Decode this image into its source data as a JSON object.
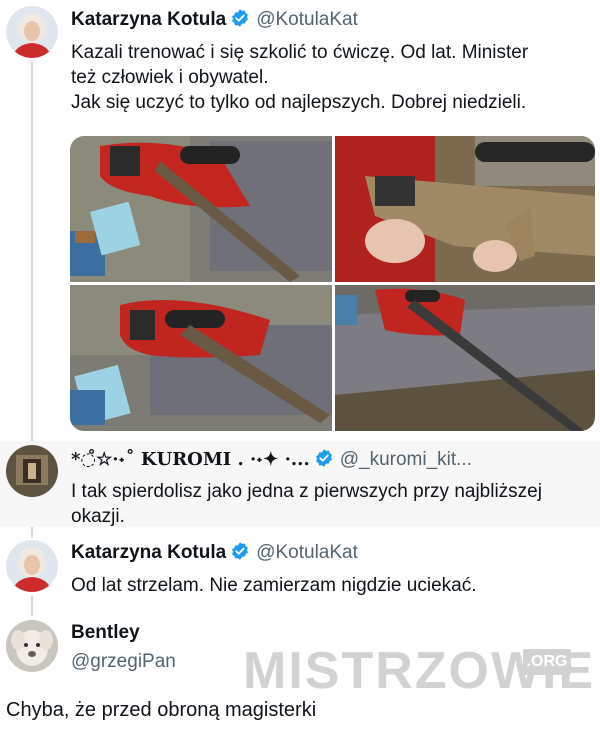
{
  "tweet1": {
    "author_name": "Katarzyna Kotula",
    "author_handle": "@KotulaKat",
    "text_line1": "Kazali trenować i się szkolić to ćwiczę. Od lat. Minister",
    "text_line2": "też człowiek i obywatel.",
    "text_line3": "Jak się uczyć to tylko od najlepszych. Dobrej niedzieli."
  },
  "reply1": {
    "author_name": "*◌̊☆·˖˚ 𝐊𝐔𝐑𝐎𝐌𝐈 .  ·˖✦ ·...",
    "author_handle": "@_kuromi_kit...",
    "text_line1": "I tak spierdolisz jako jedna z pierwszych przy najbliższej",
    "text_line2": "okazji."
  },
  "tweet2": {
    "author_name": "Katarzyna Kotula",
    "author_handle": "@KotulaKat",
    "text": "Od lat strzelam. Nie zamierzam nigdzie uciekać."
  },
  "tweet3": {
    "author_name": "Bentley",
    "author_handle": "@grzegiPan"
  },
  "watermark": {
    "text": "MISTRZOWIE",
    "suffix": ".ORG"
  },
  "caption": "Chyba, że przed obroną magisterki",
  "colors": {
    "verified_blue": "#1d9bf0",
    "text": "#0f1419",
    "secondary": "#536471"
  }
}
